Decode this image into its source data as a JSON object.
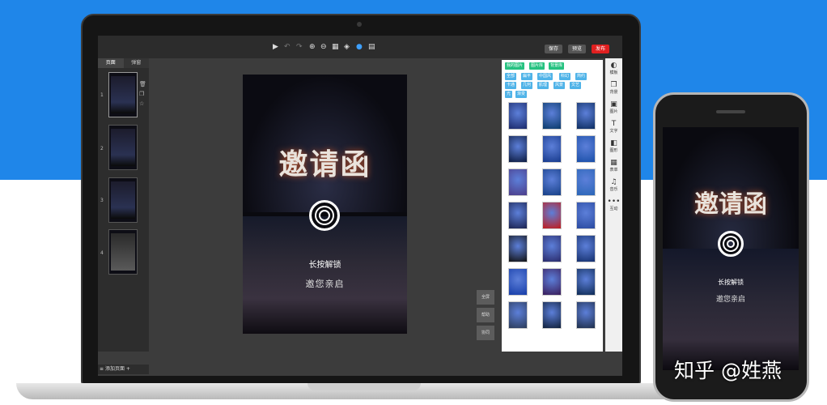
{
  "topbar": {
    "save_label": "保存",
    "preview_label": "预览",
    "publish_label": "发布"
  },
  "left_panel": {
    "tabs": [
      "页面",
      "弹窗"
    ],
    "pages": [
      "1",
      "2",
      "3",
      "4"
    ],
    "add_page": "添加页面"
  },
  "canvas": {
    "title": "邀请函",
    "press_text": "长按解锁",
    "invite_text": "邀您亲启"
  },
  "side_tools": [
    "全屏",
    "帮助",
    "协同"
  ],
  "image_panel": {
    "tabs": [
      "我的图片",
      "图片库",
      "背景库"
    ],
    "categories": [
      "全部",
      "扁平",
      "中国风",
      "科幻",
      "简约",
      "卡通",
      "几何",
      "肌理",
      "风景",
      "文艺",
      "光",
      "渐变"
    ]
  },
  "right_toolbar": [
    "模板",
    "背景",
    "图片",
    "文字",
    "图形",
    "表单",
    "音乐",
    "互动"
  ],
  "phone": {
    "title": "邀请函",
    "press_text": "长按解锁",
    "invite_text": "邀您亲启"
  },
  "watermark": "知乎 @姓燕",
  "colors": {
    "accent_blue": "#1f86e9",
    "publish_red": "#e02020",
    "tag_green": "#26c281",
    "tag_blue": "#4fb3e8"
  }
}
